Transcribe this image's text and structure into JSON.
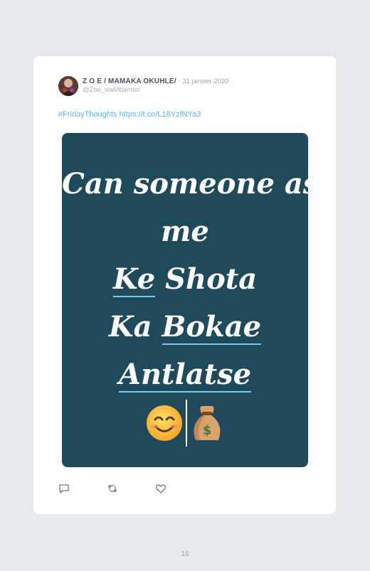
{
  "tweet": {
    "author_name": "Z O E / MAMAKA OKUHLE/",
    "date": "· 31 janvier 2020",
    "handle": "@Zoe_waMbambo",
    "hashtag": "#FridayThoughts",
    "link": "https://t.co/L18YzfNYa3",
    "media_lines": [
      "Can someone ask",
      "me",
      "Ke",
      "Shota",
      "Ka",
      "Bokae",
      "Antlatse"
    ],
    "emojis": [
      "smiling-face-emoji",
      "money-bag-emoji"
    ]
  },
  "footer": {
    "page_number": "16"
  },
  "colors": {
    "background": "#e6eaed",
    "media_background": "#1f4a5b",
    "link": "#5fb4e6"
  }
}
